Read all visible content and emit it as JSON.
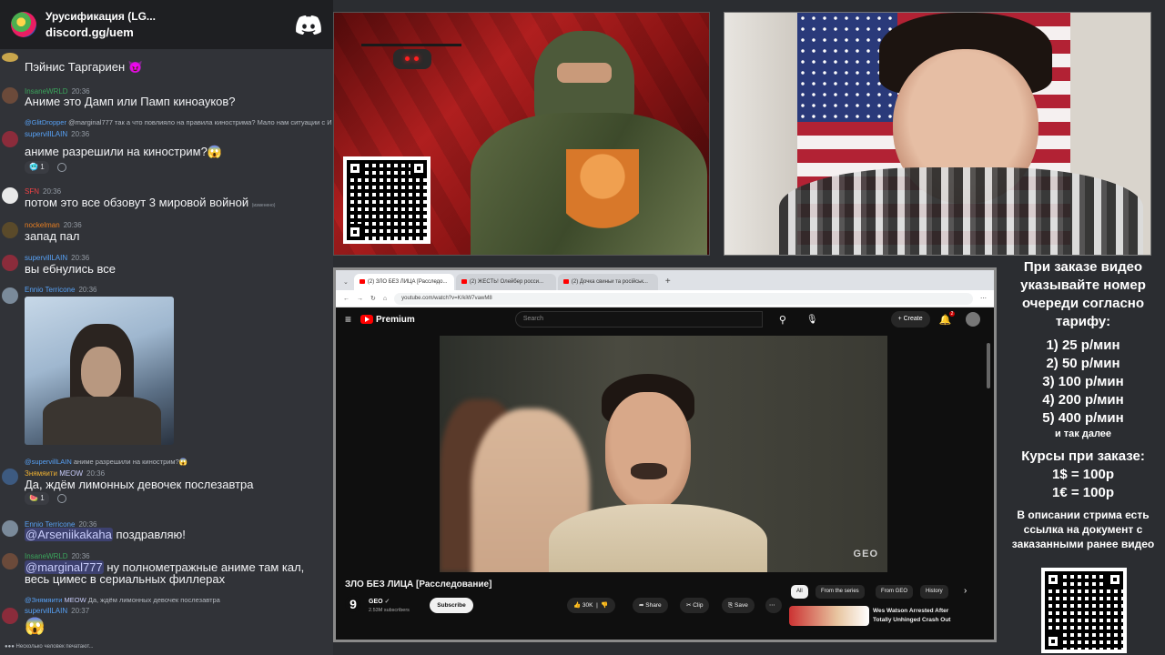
{
  "chat": {
    "server_name": "Урусификация (LG...",
    "server_link": "discord.gg/uem",
    "messages": [
      {
        "text": "Пэйнис Таргариен 😈"
      },
      {
        "user": "InsaneWRLD",
        "time": "20:36",
        "text": "Аниме это Дамп или Памп киноауков?"
      },
      {
        "reply_user": "@GlitDropper",
        "reply_text": "@marginal777 так а что повлияло на правила кинострима? Мало нам ситуации с И",
        "user": "supervillLAIN",
        "time": "20:36",
        "text": "аниме разрешили на кинострим?😱",
        "reaction": "1"
      },
      {
        "user": "SFN",
        "time": "20:36",
        "text": "потом это все обзовут 3 мировой войной",
        "edited": "(изменено)"
      },
      {
        "user": "nockelman",
        "time": "20:36",
        "text": "запад пал"
      },
      {
        "user": "supervillLAIN",
        "time": "20:36",
        "text": "вы ебнулись все"
      },
      {
        "user": "Ennio Terricone",
        "time": "20:36"
      },
      {
        "reply_user": "@supervillLAIN",
        "reply_text": "аниме разрешили на кинострим?😱",
        "user": "Знямяити",
        "badge": "MEOW",
        "time": "20:36",
        "text": "Да, ждём лимонных девочек послезавтра",
        "reaction": "1"
      },
      {
        "user": "Ennio Terricone",
        "time": "20:36",
        "mention": "@Arseniikakaha",
        "text": " поздравляю!"
      },
      {
        "user": "InsaneWRLD",
        "time": "20:36",
        "mention": "@marginal777",
        "text": " ну полнометражные аниме там кал,",
        "text2": "весь цимес в сериальных филлерах"
      },
      {
        "reply_user": "@Знямяити",
        "reply_badge": "MEOW",
        "reply_text": "Да, ждём лимонных девочек послезавтра",
        "user": "supervillLAIN",
        "time": "20:37",
        "text": "😱"
      }
    ],
    "typing": "Несколько человек печатают..."
  },
  "browser": {
    "tabs": [
      "(2) ЗЛО БЕЗ ЛИЦА [Расследо...",
      "(2) ЖЕСТЬ! Олейбер росси...",
      "(2) Дочка свиньи та російськ..."
    ],
    "url": "youtube.com/watch?v=K/kiW7vawM8",
    "yt_brand": "Premium",
    "search_placeholder": "Search",
    "create_label": "Create",
    "notif_count": "2",
    "video_title": "ЗЛО БЕЗ ЛИЦА [Расследование]",
    "channel_initial": "9",
    "channel_name": "GEO",
    "channel_subs": "2.53M subscribers",
    "subscribe_label": "Subscribe",
    "like_count": "30K",
    "share_label": "Share",
    "clip_label": "Clip",
    "save_label": "Save",
    "watermark": "GEO",
    "chips": [
      "All",
      "From the series",
      "From GEO",
      "History"
    ],
    "rec_title": "Wes Watson Arrested After Totally Unhinged Crash Out"
  },
  "info": {
    "line1": "При заказе видео указывайте номер очереди согласно тарифу:",
    "tariffs": [
      "1) 25 р/мин",
      "2) 50 р/мин",
      "3) 100 р/мин",
      "4) 200 р/мин",
      "5) 400 р/мин"
    ],
    "etc": "и так далее",
    "rates_title": "Курсы при заказе:",
    "rate1": "1$ = 100р",
    "rate2": "1€ = 100р",
    "desc": "В описании стрима есть ссылка на документ с заказанными ранее видео"
  },
  "colors": {
    "accent_red": "#ff0000",
    "discord_bg": "#313338",
    "username_green": "#3ba55c"
  }
}
